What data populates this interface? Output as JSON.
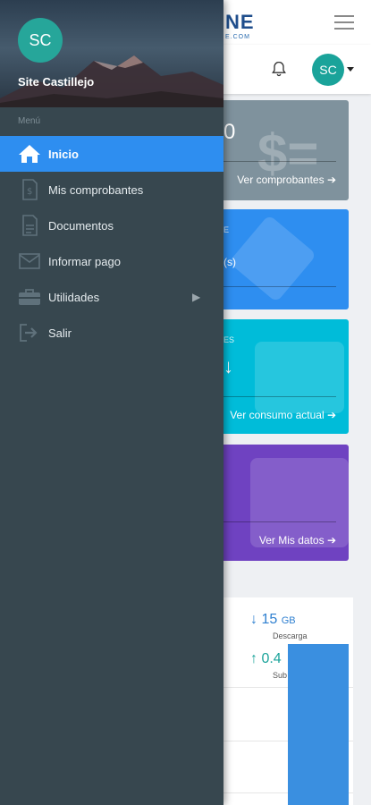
{
  "topbar": {
    "logo_text": "NE",
    "logo_sub": "E.COM",
    "user_initials": "SC"
  },
  "cards": {
    "gray": {
      "value": "0",
      "link": "Ver comprobantes ➔"
    },
    "blue": {
      "label": "E",
      "fragment": "(s)"
    },
    "teal": {
      "label": "ES",
      "link": "Ver consumo actual ➔"
    },
    "purple": {
      "link": "Ver Mis datos ➔"
    }
  },
  "stats": {
    "download_value": "↓ 15",
    "download_unit": "GB",
    "download_label": "Descarga",
    "upload_value": "↑ 0.4",
    "upload_label": "Sub"
  },
  "drawer": {
    "initials": "SC",
    "name": "Site Castillejo",
    "section_label": "Menú",
    "items": [
      {
        "label": "Inicio",
        "icon": "home-icon",
        "active": true
      },
      {
        "label": "Mis comprobantes",
        "icon": "receipt-icon"
      },
      {
        "label": "Documentos",
        "icon": "document-icon"
      },
      {
        "label": "Informar pago",
        "icon": "envelope-icon"
      },
      {
        "label": "Utilidades",
        "icon": "toolbox-icon",
        "has_submenu": true
      },
      {
        "label": "Salir",
        "icon": "logout-icon"
      }
    ]
  },
  "colors": {
    "drawer_bg": "#37474f",
    "active_item": "#2e8ef0",
    "avatar": "#26a69a"
  }
}
